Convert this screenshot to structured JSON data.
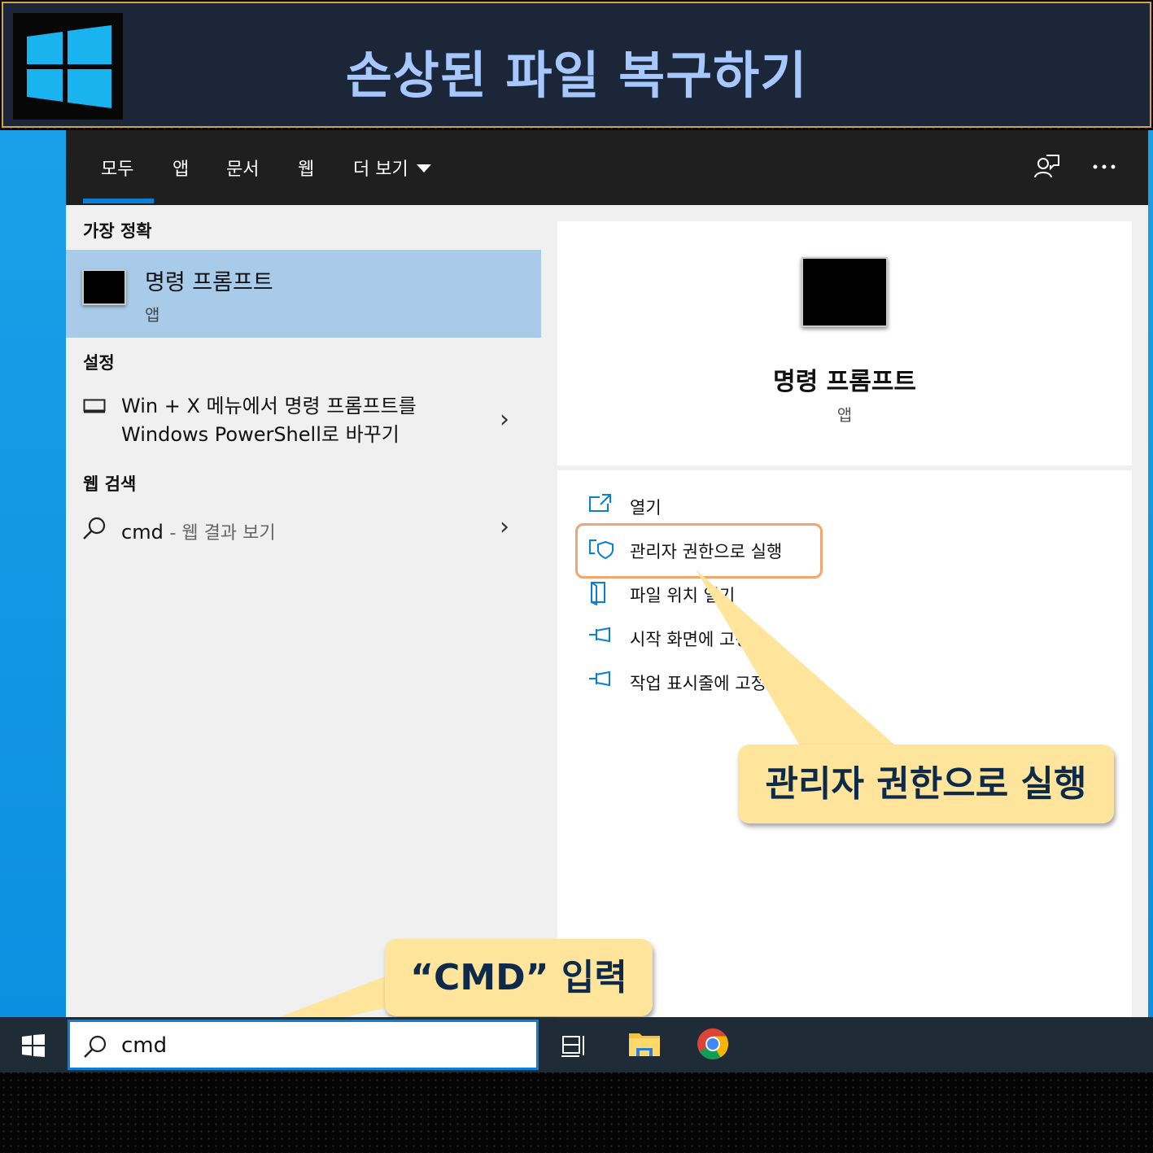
{
  "banner": {
    "title": "손상된 파일 복구하기",
    "logo_icon": "windows-logo-icon"
  },
  "tabs": [
    {
      "label": "모두",
      "active": true
    },
    {
      "label": "앱"
    },
    {
      "label": "문서"
    },
    {
      "label": "웹"
    },
    {
      "label": "더 보기"
    }
  ],
  "toolbar": {
    "feedback_icon": "feedback-icon",
    "more_icon": "more-options-icon"
  },
  "best_match": {
    "heading": "가장 정확",
    "title": "명령 프롬프트",
    "subtitle": "앱"
  },
  "settings": {
    "heading": "설정",
    "line1": "Win + X 메뉴에서 명령 프롬프트를",
    "line2": "Windows PowerShell로 바꾸기"
  },
  "web_search": {
    "heading": "웹 검색",
    "query": "cmd",
    "suffix": "- 웹 결과 보기"
  },
  "preview": {
    "title": "명령 프롬프트",
    "subtitle": "앱"
  },
  "actions": [
    {
      "label": "열기",
      "icon": "open-icon"
    },
    {
      "label": "관리자 권한으로 실행",
      "icon": "shield-icon"
    },
    {
      "label": "파일 위치 열기",
      "icon": "file-location-icon"
    },
    {
      "label": "시작 화면에 고정",
      "icon": "pin-icon"
    },
    {
      "label": "작업 표시줄에 고정",
      "icon": "pin-icon"
    }
  ],
  "callouts": {
    "admin": "관리자 권한으로 실행",
    "cmd": "“CMD” 입력"
  },
  "taskbar": {
    "search_value": "cmd"
  },
  "colors": {
    "accent": "#0a7fd8",
    "callout_bg": "#ffe59c",
    "banner_bg": "#1b2638",
    "banner_title": "#a6c8ff",
    "highlight_border": "#f2a56f"
  }
}
